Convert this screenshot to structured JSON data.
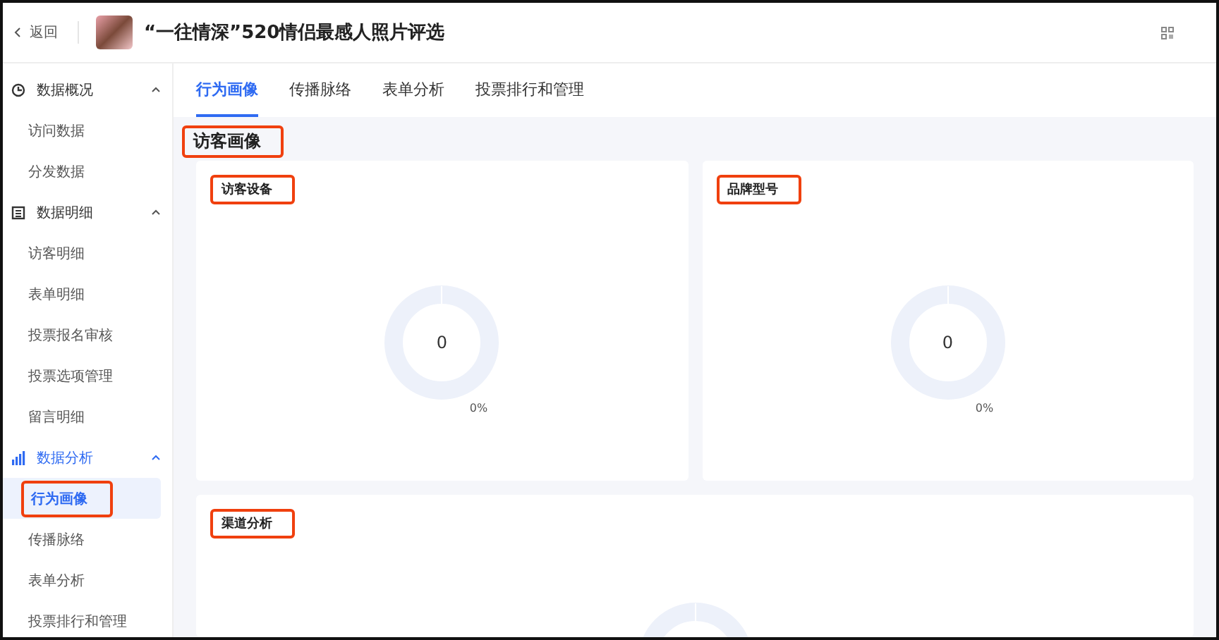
{
  "header": {
    "back_label": "返回",
    "title": "“一往情深”520情侣最感人照片评选"
  },
  "sidebar": {
    "groups": [
      {
        "label": "数据概况",
        "expanded": true,
        "children": [
          {
            "label": "访问数据",
            "selected": false,
            "highlighted": false
          },
          {
            "label": "分发数据",
            "selected": false,
            "highlighted": false
          }
        ]
      },
      {
        "label": "数据明细",
        "expanded": true,
        "children": [
          {
            "label": "访客明细",
            "selected": false,
            "highlighted": false
          },
          {
            "label": "表单明细",
            "selected": false,
            "highlighted": false
          },
          {
            "label": "投票报名审核",
            "selected": false,
            "highlighted": false
          },
          {
            "label": "投票选项管理",
            "selected": false,
            "highlighted": false
          },
          {
            "label": "留言明细",
            "selected": false,
            "highlighted": false
          }
        ]
      },
      {
        "label": "数据分析",
        "expanded": true,
        "children": [
          {
            "label": "行为画像",
            "selected": true,
            "highlighted": true
          },
          {
            "label": "传播脉络",
            "selected": false,
            "highlighted": false
          },
          {
            "label": "表单分析",
            "selected": false,
            "highlighted": false
          },
          {
            "label": "投票排行和管理",
            "selected": false,
            "highlighted": false
          }
        ]
      }
    ]
  },
  "tabs": [
    {
      "label": "行为画像",
      "selected": true
    },
    {
      "label": "传播脉络",
      "selected": false
    },
    {
      "label": "表单分析",
      "selected": false
    },
    {
      "label": "投票排行和管理",
      "selected": false
    }
  ],
  "section": {
    "title": "访客画像",
    "highlighted": true
  },
  "cards": [
    {
      "title": "访客设备",
      "highlighted": true,
      "total": "0",
      "percent_label": "0%"
    },
    {
      "title": "品牌型号",
      "highlighted": true,
      "total": "0",
      "percent_label": "0%"
    },
    {
      "title": "渠道分析",
      "highlighted": true
    }
  ]
}
